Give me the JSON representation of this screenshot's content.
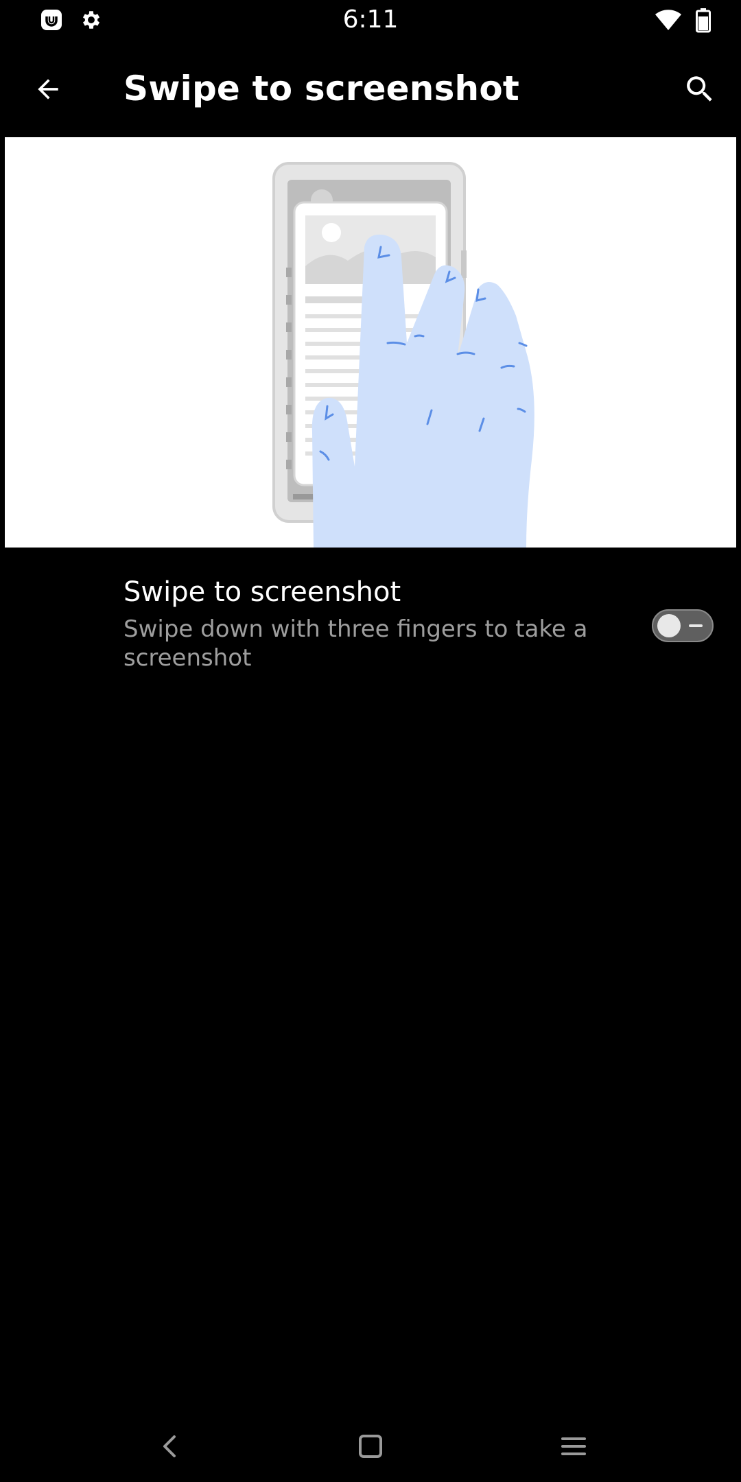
{
  "status_bar": {
    "time": "6:11",
    "left_icons": [
      "notification-app-icon",
      "settings-gear-icon"
    ],
    "right_icons": [
      "wifi-icon",
      "battery-icon"
    ]
  },
  "app_bar": {
    "title": "Swipe to screenshot",
    "back_icon": "arrow-back-icon",
    "search_icon": "search-icon"
  },
  "illustration": {
    "icon": "three-finger-swipe-illustration"
  },
  "setting": {
    "title": "Swipe to screenshot",
    "summary": "Swipe down with three fingers to take a screenshot",
    "enabled": false
  },
  "nav_bar": {
    "icons": [
      "nav-back-icon",
      "nav-home-icon",
      "nav-recents-icon"
    ]
  },
  "colors": {
    "background": "#000000",
    "text_primary": "#ffffff",
    "text_secondary": "#9e9e9e",
    "hand": "#cfe0fb",
    "hand_lines": "#5b8ee6"
  }
}
